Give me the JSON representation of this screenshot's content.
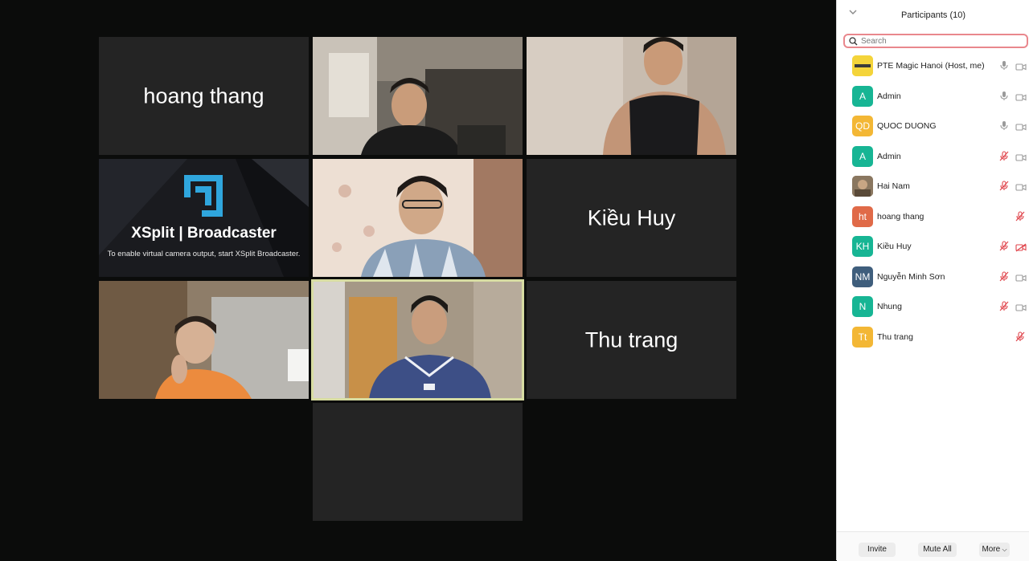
{
  "panel": {
    "title": "Participants (10)",
    "search_placeholder": "Search",
    "footer": {
      "invite": "Invite",
      "mute_all": "Mute All",
      "more": "More"
    }
  },
  "participants": [
    {
      "name": "PTE Magic Hanoi (Host, me)",
      "avatar": "",
      "avatar_color": "#f4d43a",
      "mic": "on",
      "camera": "on"
    },
    {
      "name": "Admin",
      "avatar": "A",
      "avatar_color": "#17b594",
      "mic": "on",
      "camera": "on"
    },
    {
      "name": "QUOC DUONG",
      "avatar": "QD",
      "avatar_color": "#f3b735",
      "mic": "on",
      "camera": "on"
    },
    {
      "name": "Admin",
      "avatar": "A",
      "avatar_color": "#17b594",
      "mic": "muted",
      "camera": "on"
    },
    {
      "name": "Hai Nam",
      "avatar": "",
      "avatar_color": "#8a7760",
      "mic": "muted",
      "camera": "on"
    },
    {
      "name": "hoang thang",
      "avatar": "ht",
      "avatar_color": "#e06a48",
      "mic": "muted",
      "camera": "none"
    },
    {
      "name": "Kiều Huy",
      "avatar": "KH",
      "avatar_color": "#17b594",
      "mic": "muted",
      "camera": "off"
    },
    {
      "name": "Nguyễn Minh Sơn",
      "avatar": "NM",
      "avatar_color": "#3f5e7c",
      "mic": "muted",
      "camera": "on"
    },
    {
      "name": "Nhung",
      "avatar": "N",
      "avatar_color": "#17b594",
      "mic": "muted",
      "camera": "on"
    },
    {
      "name": "Thu trang",
      "avatar": "Tt",
      "avatar_color": "#f3b735",
      "mic": "muted",
      "camera": "none"
    }
  ],
  "gallery": {
    "tile_name_1": "hoang thang",
    "tile_name_2": "Kiều Huy",
    "tile_name_3": "Thu trang",
    "xsplit_title": "XSplit | Broadcaster",
    "xsplit_message": "To enable virtual camera output, start XSplit Broadcaster."
  },
  "colors": {
    "tile_bg": "#242424",
    "active_border": "#d7dca2",
    "muted_red": "#e0454c",
    "search_focus": "#e9878d"
  }
}
